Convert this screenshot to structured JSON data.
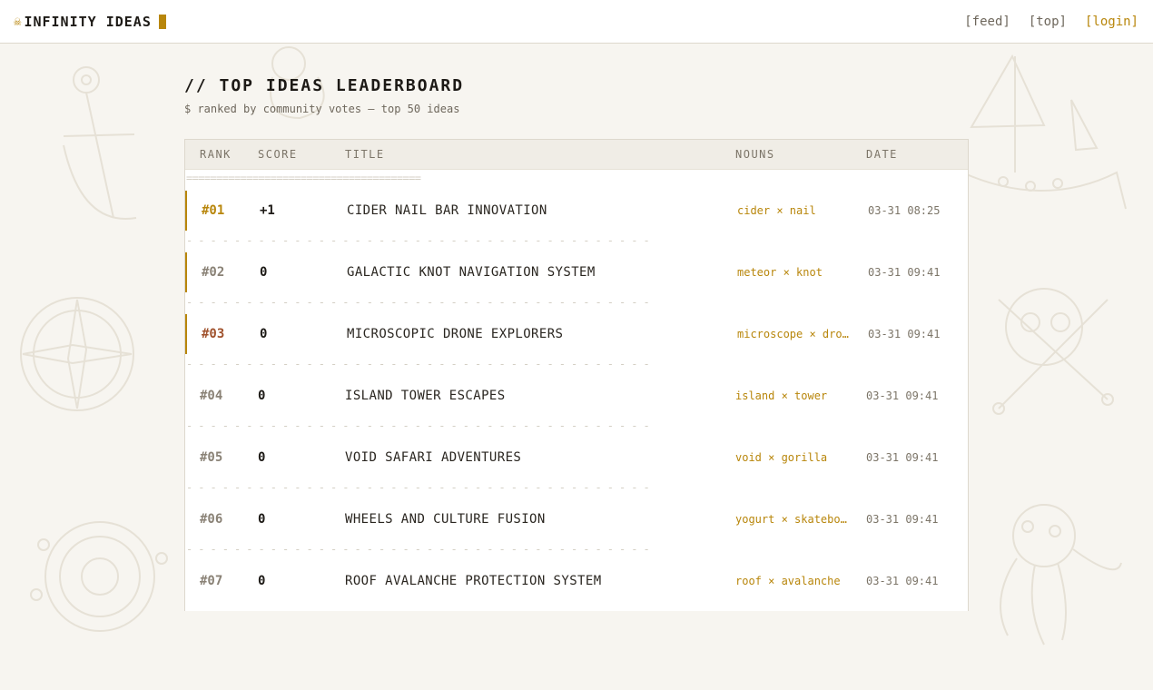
{
  "header": {
    "skull_glyph": "☠",
    "brand": "INFINITY IDEAS",
    "nav": [
      "[feed]",
      "[top]",
      "[login]"
    ]
  },
  "page": {
    "title": "// TOP IDEAS LEADERBOARD",
    "subtitle": "$ ranked by community votes — top 50 ideas"
  },
  "table": {
    "columns": [
      "RANK",
      "SCORE",
      "TITLE",
      "NOUNS",
      "DATE"
    ],
    "rule": "=======================================",
    "separator": "- - - - - - - - - - - - - - - - - - - - - - - - - - - - - - - - - - - - - - -",
    "rows": [
      {
        "rank": "#01",
        "score": "+1",
        "title": "CIDER NAIL BAR INNOVATION",
        "nouns": "cider × nail",
        "date": "03-31 08:25"
      },
      {
        "rank": "#02",
        "score": "0",
        "title": "GALACTIC KNOT NAVIGATION SYSTEM",
        "nouns": "meteor × knot",
        "date": "03-31 09:41"
      },
      {
        "rank": "#03",
        "score": "0",
        "title": "MICROSCOPIC DRONE EXPLORERS",
        "nouns": "microscope × drone",
        "date": "03-31 09:41"
      },
      {
        "rank": "#04",
        "score": "0",
        "title": "ISLAND TOWER ESCAPES",
        "nouns": "island × tower",
        "date": "03-31 09:41"
      },
      {
        "rank": "#05",
        "score": "0",
        "title": "VOID SAFARI ADVENTURES",
        "nouns": "void × gorilla",
        "date": "03-31 09:41"
      },
      {
        "rank": "#06",
        "score": "0",
        "title": "WHEELS AND CULTURE FUSION",
        "nouns": "yogurt × skateboard",
        "date": "03-31 09:41"
      },
      {
        "rank": "#07",
        "score": "0",
        "title": "ROOF AVALANCHE PROTECTION SYSTEM",
        "nouns": "roof × avalanche",
        "date": "03-31 09:41"
      }
    ]
  },
  "colors": {
    "accent": "#b8860b",
    "rank1": "#b8860b",
    "rank2": "#8a8276",
    "rank3": "#a0522d",
    "background": "#f7f5f0"
  }
}
